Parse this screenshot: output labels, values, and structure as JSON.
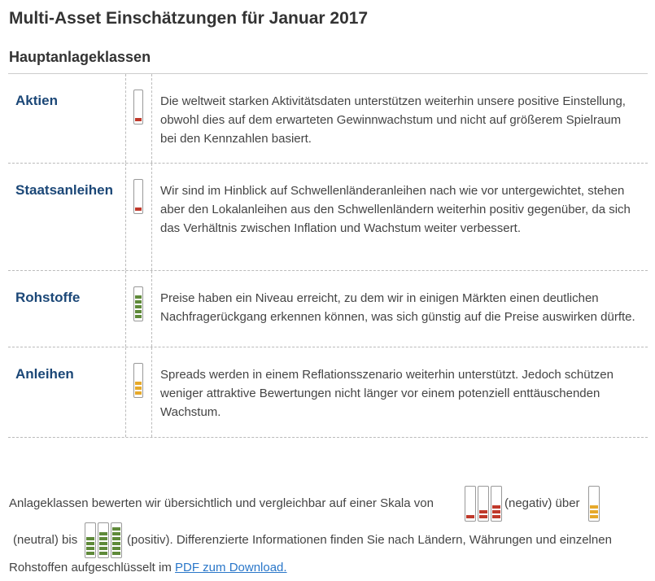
{
  "page": {
    "title": "Multi-Asset Einschätzungen für Januar 2017",
    "subtitle": "Hauptanlageklassen"
  },
  "colors": {
    "negative": "#c0392b",
    "neutral": "#e6a92a",
    "positive": "#5f8a3a",
    "heading_blue": "#1b4777",
    "link": "#2a77c9"
  },
  "rows": [
    {
      "name": "Aktien",
      "rating_level": 1,
      "rating_color": "negative",
      "text": "Die weltweit starken Aktivitätsdaten unterstützen weiterhin unsere positive Einstellung, obwohl dies auf dem erwarteten Gewinnwachstum und nicht auf größerem Spielraum bei den Kennzahlen basiert."
    },
    {
      "name": "Staatsanleihen",
      "rating_level": 1,
      "rating_color": "negative",
      "text": "Wir sind im Hinblick auf Schwellenländeranleihen nach wie vor untergewichtet, stehen aber den Lokalanleihen aus den Schwellenländern weiterhin positiv gegenüber, da sich das Verhältnis zwischen Inflation und Wachstum weiter verbessert."
    },
    {
      "name": "Rohstoffe",
      "rating_level": 5,
      "rating_color": "positive",
      "text": "Preise haben ein Niveau erreicht, zu dem wir in einigen Märkten einen deutlichen Nachfragerückgang erkennen können, was sich günstig auf die Preise auswirken dürfte."
    },
    {
      "name": "Anleihen",
      "rating_level": 3,
      "rating_color": "neutral",
      "text": "Spreads werden in einem Reflationsszenario weiterhin unterstützt. Jedoch schützen weniger attraktive Bewertungen nicht länger vor einem potenziell enttäuschenden Wachstum."
    }
  ],
  "footer": {
    "part1": "Anlageklassen bewerten wir übersichtlich und vergleichbar auf einer Skala von",
    "negative_label": "(negativ) über",
    "neutral_label": "(neutral) bis",
    "part2": "(positiv). Differenzierte Informationen finden Sie nach Ländern, Währungen und einzelnen",
    "part3": "Rohstoffen aufgeschlüsselt im",
    "link_text": "PDF zum Download.",
    "scale_negative_levels": [
      1,
      2,
      3
    ],
    "scale_neutral_levels": [
      3
    ],
    "scale_positive_levels": [
      4,
      5,
      6
    ]
  }
}
